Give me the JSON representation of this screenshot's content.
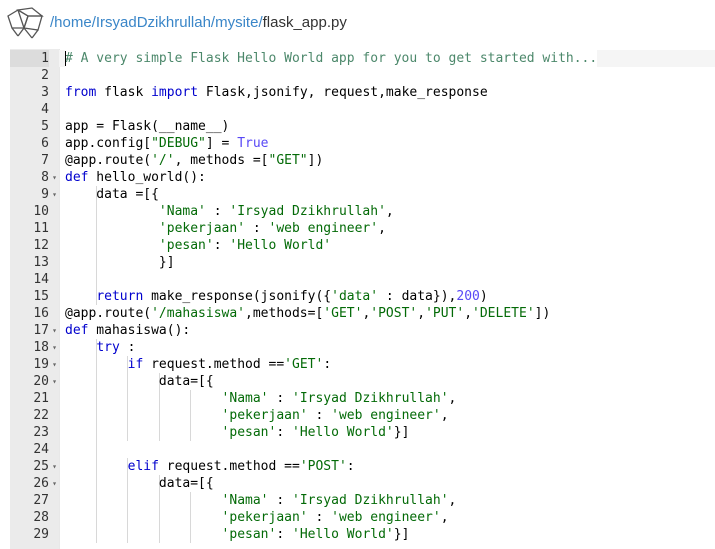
{
  "header": {
    "path_prefix": "/",
    "crumbs": [
      "home",
      "IrsyadDzikhrullah",
      "mysite"
    ],
    "file_name": "flask_app.py",
    "logo_icon": "pythonanywhere-logo-icon"
  },
  "editor": {
    "active_line": 1,
    "lines": [
      {
        "n": "1",
        "fold": false,
        "tokens": [
          {
            "t": "# A very simple Flask Hello World app for you to get started with...",
            "c": "cmt"
          }
        ]
      },
      {
        "n": "2",
        "fold": false,
        "tokens": []
      },
      {
        "n": "3",
        "fold": false,
        "tokens": [
          {
            "t": "from",
            "c": "kw"
          },
          {
            "t": " flask ",
            "c": ""
          },
          {
            "t": "import",
            "c": "kw"
          },
          {
            "t": " Flask,jsonify, request,make_response",
            "c": ""
          }
        ]
      },
      {
        "n": "4",
        "fold": false,
        "tokens": []
      },
      {
        "n": "5",
        "fold": false,
        "tokens": [
          {
            "t": "app = Flask(__name__)",
            "c": ""
          }
        ]
      },
      {
        "n": "6",
        "fold": false,
        "tokens": [
          {
            "t": "app.config[",
            "c": ""
          },
          {
            "t": "\"DEBUG\"",
            "c": "str"
          },
          {
            "t": "] = ",
            "c": ""
          },
          {
            "t": "True",
            "c": "bool"
          }
        ]
      },
      {
        "n": "7",
        "fold": false,
        "tokens": [
          {
            "t": "@app.route(",
            "c": ""
          },
          {
            "t": "'/'",
            "c": "str"
          },
          {
            "t": ", methods =[",
            "c": ""
          },
          {
            "t": "\"GET\"",
            "c": "str"
          },
          {
            "t": "])",
            "c": ""
          }
        ]
      },
      {
        "n": "8",
        "fold": true,
        "tokens": [
          {
            "t": "def",
            "c": "kw"
          },
          {
            "t": " hello_world():",
            "c": ""
          }
        ]
      },
      {
        "n": "9",
        "fold": true,
        "tokens": [
          {
            "t": "    data =[{",
            "c": ""
          }
        ]
      },
      {
        "n": "10",
        "fold": false,
        "tokens": [
          {
            "t": "            ",
            "c": ""
          },
          {
            "t": "'Nama'",
            "c": "str"
          },
          {
            "t": " : ",
            "c": ""
          },
          {
            "t": "'Irsyad Dzikhrullah'",
            "c": "str"
          },
          {
            "t": ",",
            "c": ""
          }
        ]
      },
      {
        "n": "11",
        "fold": false,
        "tokens": [
          {
            "t": "            ",
            "c": ""
          },
          {
            "t": "'pekerjaan'",
            "c": "str"
          },
          {
            "t": " : ",
            "c": ""
          },
          {
            "t": "'web engineer'",
            "c": "str"
          },
          {
            "t": ",",
            "c": ""
          }
        ]
      },
      {
        "n": "12",
        "fold": false,
        "tokens": [
          {
            "t": "            ",
            "c": ""
          },
          {
            "t": "'pesan'",
            "c": "str"
          },
          {
            "t": ": ",
            "c": ""
          },
          {
            "t": "'Hello World'",
            "c": "str"
          }
        ]
      },
      {
        "n": "13",
        "fold": false,
        "tokens": [
          {
            "t": "            }]",
            "c": ""
          }
        ]
      },
      {
        "n": "14",
        "fold": false,
        "tokens": []
      },
      {
        "n": "15",
        "fold": false,
        "tokens": [
          {
            "t": "    ",
            "c": ""
          },
          {
            "t": "return",
            "c": "kw"
          },
          {
            "t": " make_response(jsonify({",
            "c": ""
          },
          {
            "t": "'data'",
            "c": "str"
          },
          {
            "t": " : data}),",
            "c": ""
          },
          {
            "t": "200",
            "c": "bool"
          },
          {
            "t": ")",
            "c": ""
          }
        ]
      },
      {
        "n": "16",
        "fold": false,
        "tokens": [
          {
            "t": "@app.route(",
            "c": ""
          },
          {
            "t": "'/mahasiswa'",
            "c": "str"
          },
          {
            "t": ",methods=[",
            "c": ""
          },
          {
            "t": "'GET'",
            "c": "str"
          },
          {
            "t": ",",
            "c": ""
          },
          {
            "t": "'POST'",
            "c": "str"
          },
          {
            "t": ",",
            "c": ""
          },
          {
            "t": "'PUT'",
            "c": "str"
          },
          {
            "t": ",",
            "c": ""
          },
          {
            "t": "'DELETE'",
            "c": "str"
          },
          {
            "t": "])",
            "c": ""
          }
        ]
      },
      {
        "n": "17",
        "fold": true,
        "tokens": [
          {
            "t": "def",
            "c": "kw"
          },
          {
            "t": " mahasiswa():",
            "c": ""
          }
        ]
      },
      {
        "n": "18",
        "fold": true,
        "tokens": [
          {
            "t": "    ",
            "c": ""
          },
          {
            "t": "try",
            "c": "kw"
          },
          {
            "t": " :",
            "c": ""
          }
        ]
      },
      {
        "n": "19",
        "fold": true,
        "tokens": [
          {
            "t": "        ",
            "c": ""
          },
          {
            "t": "if",
            "c": "kw"
          },
          {
            "t": " request.method ==",
            "c": ""
          },
          {
            "t": "'GET'",
            "c": "str"
          },
          {
            "t": ":",
            "c": ""
          }
        ]
      },
      {
        "n": "20",
        "fold": true,
        "tokens": [
          {
            "t": "            data=[{",
            "c": ""
          }
        ]
      },
      {
        "n": "21",
        "fold": false,
        "tokens": [
          {
            "t": "                    ",
            "c": ""
          },
          {
            "t": "'Nama'",
            "c": "str"
          },
          {
            "t": " : ",
            "c": ""
          },
          {
            "t": "'Irsyad Dzikhrullah'",
            "c": "str"
          },
          {
            "t": ",",
            "c": ""
          }
        ]
      },
      {
        "n": "22",
        "fold": false,
        "tokens": [
          {
            "t": "                    ",
            "c": ""
          },
          {
            "t": "'pekerjaan'",
            "c": "str"
          },
          {
            "t": " : ",
            "c": ""
          },
          {
            "t": "'web engineer'",
            "c": "str"
          },
          {
            "t": ",",
            "c": ""
          }
        ]
      },
      {
        "n": "23",
        "fold": false,
        "tokens": [
          {
            "t": "                    ",
            "c": ""
          },
          {
            "t": "'pesan'",
            "c": "str"
          },
          {
            "t": ": ",
            "c": ""
          },
          {
            "t": "'Hello World'",
            "c": "str"
          },
          {
            "t": "}]",
            "c": ""
          }
        ]
      },
      {
        "n": "24",
        "fold": false,
        "tokens": []
      },
      {
        "n": "25",
        "fold": true,
        "tokens": [
          {
            "t": "        ",
            "c": ""
          },
          {
            "t": "elif",
            "c": "kw"
          },
          {
            "t": " request.method ==",
            "c": ""
          },
          {
            "t": "'POST'",
            "c": "str"
          },
          {
            "t": ":",
            "c": ""
          }
        ]
      },
      {
        "n": "26",
        "fold": true,
        "tokens": [
          {
            "t": "            data=[{",
            "c": ""
          }
        ]
      },
      {
        "n": "27",
        "fold": false,
        "tokens": [
          {
            "t": "                    ",
            "c": ""
          },
          {
            "t": "'Nama'",
            "c": "str"
          },
          {
            "t": " : ",
            "c": ""
          },
          {
            "t": "'Irsyad Dzikhrullah'",
            "c": "str"
          },
          {
            "t": ",",
            "c": ""
          }
        ]
      },
      {
        "n": "28",
        "fold": false,
        "tokens": [
          {
            "t": "                    ",
            "c": ""
          },
          {
            "t": "'pekerjaan'",
            "c": "str"
          },
          {
            "t": " : ",
            "c": ""
          },
          {
            "t": "'web engineer'",
            "c": "str"
          },
          {
            "t": ",",
            "c": ""
          }
        ]
      },
      {
        "n": "29",
        "fold": false,
        "tokens": [
          {
            "t": "                    ",
            "c": ""
          },
          {
            "t": "'pesan'",
            "c": "str"
          },
          {
            "t": ": ",
            "c": ""
          },
          {
            "t": "'Hello World'",
            "c": "str"
          },
          {
            "t": "}]",
            "c": ""
          }
        ]
      }
    ]
  },
  "colors": {
    "keyword": "#0000cd",
    "string": "#036a07",
    "comment": "#4c886b",
    "constant": "#5848f6",
    "link": "#3a86c8"
  }
}
